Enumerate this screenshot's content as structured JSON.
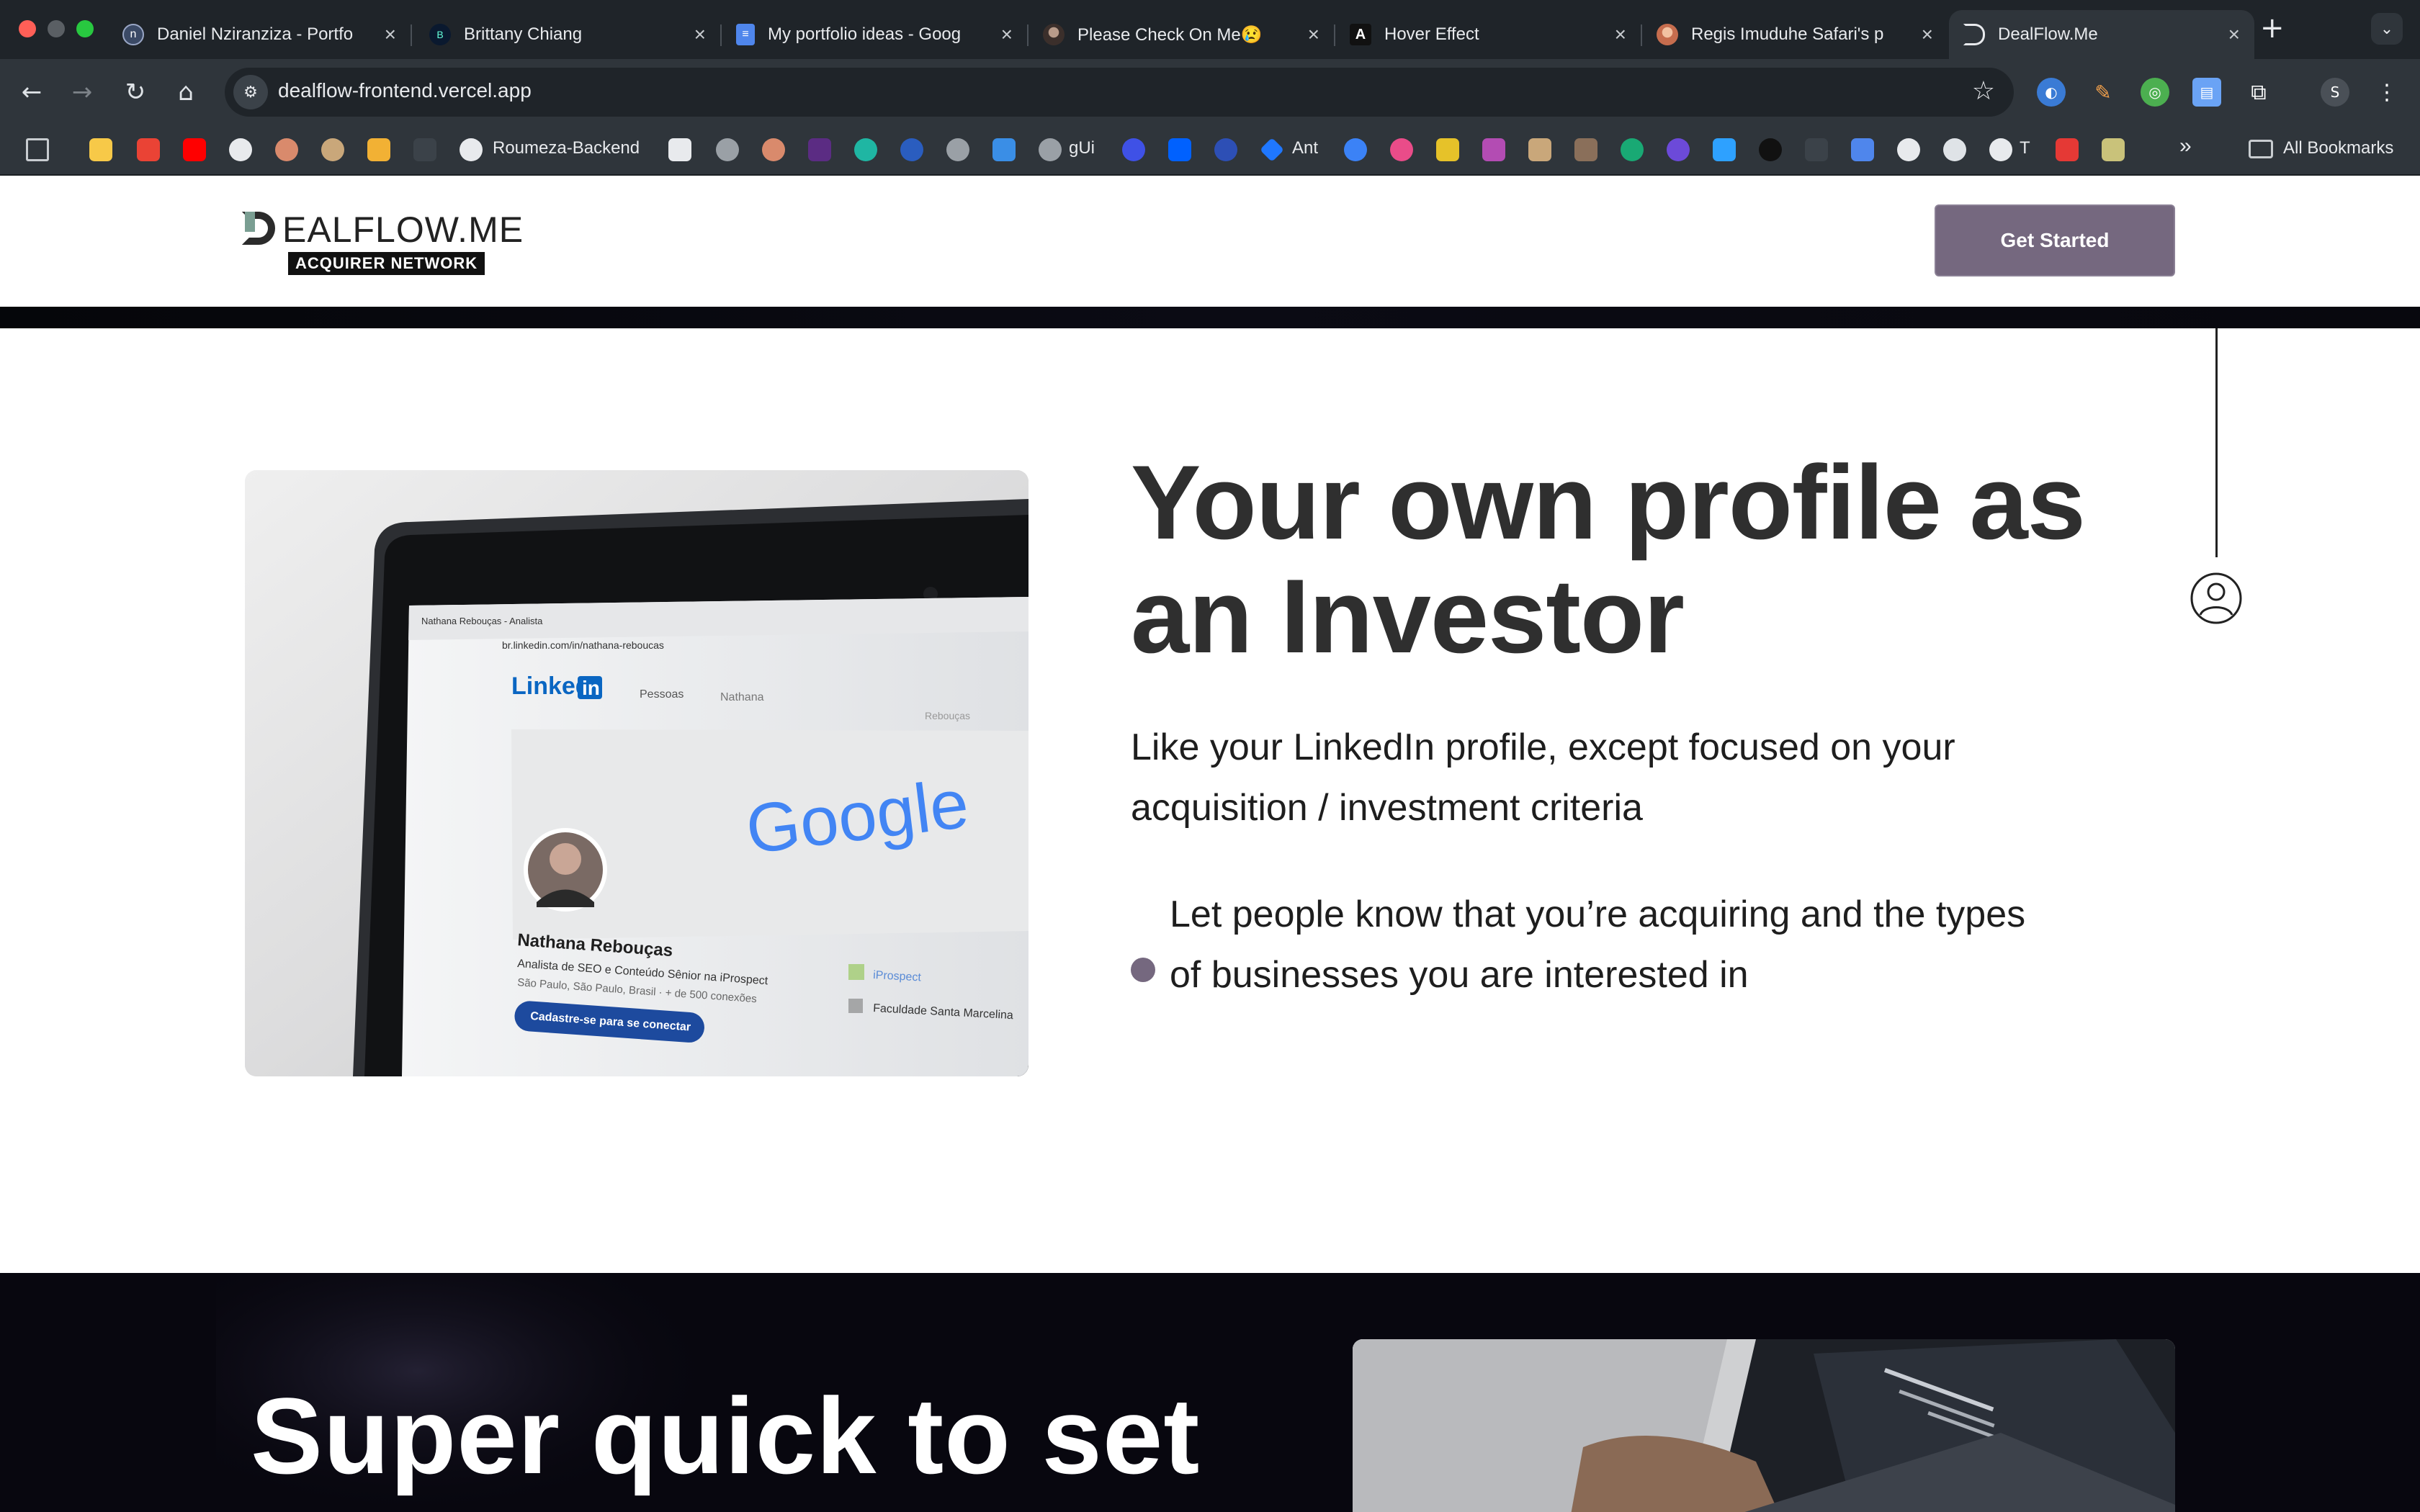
{
  "browser": {
    "tabs": [
      {
        "label": "Daniel Nziranziza - Portfo",
        "icon": "dn-logo-icon",
        "favicon_text": "n",
        "color": "#3b4a66"
      },
      {
        "label": "Brittany Chiang",
        "icon": "bc-logo-icon",
        "favicon_text": "B",
        "color": "#0a192f"
      },
      {
        "label": "My portfolio ideas - Goog",
        "icon": "google-docs-icon",
        "favicon_text": "≡",
        "color": "#4f86ec"
      },
      {
        "label": "Please Check On Me😢",
        "icon": "avatar-icon",
        "favicon_text": "",
        "color": "#6b5a55"
      },
      {
        "label": "Hover Effect",
        "icon": "a-logo-icon",
        "favicon_text": "A",
        "color": "#111111"
      },
      {
        "label": "Regis Imuduhe Safari's p",
        "icon": "avatar-icon",
        "favicon_text": "",
        "color": "#d98a6c"
      },
      {
        "label": "DealFlow.Me",
        "icon": "dealflow-icon",
        "favicon_text": "D",
        "color": "#2f353b"
      }
    ],
    "url": "dealflow-frontend.vercel.app",
    "bookmarks": {
      "roumeza": "Roumeza-Backend",
      "gui": "gUi",
      "ant": "Ant",
      "t": "T",
      "all": "All Bookmarks"
    },
    "profile_initial": "S"
  },
  "header": {
    "logo_text": "EALFLOW.ME",
    "logo_sub": "ACQUIRER NETWORK",
    "cta_label": "Get Started"
  },
  "hero": {
    "title": "Your own profile as an Investor",
    "description": "Like your LinkedIn profile, except focused on your acquisition / investment criteria",
    "bullet": "Let people know that you’re acquiring and the types of businesses you are interested in"
  },
  "laptop_screen": {
    "tab_title": "Nathana Rebouças - Analista",
    "url": "br.linkedin.com/in/nathana-reboucas",
    "linkedin_logo": "Linked",
    "linkedin_in": "in",
    "nav_people": "Pessoas",
    "nav_name": "Nathana",
    "nav_right": "Rebouças",
    "google": "Google",
    "profile_name": "Nathana Rebouças",
    "profile_headline": "Analista de SEO e Conteúdo Sênior na iProspect",
    "profile_location": "São Paulo, São Paulo, Brasil  · + de 500 conexões",
    "connect_button": "Cadastre-se para se conectar",
    "company": "iProspect",
    "school": "Faculdade Santa Marcelina"
  },
  "next_section": {
    "title": "Super quick to set"
  },
  "colors": {
    "accent": "#75687f",
    "text": "#2f2f2f",
    "dark": "#08070f"
  }
}
